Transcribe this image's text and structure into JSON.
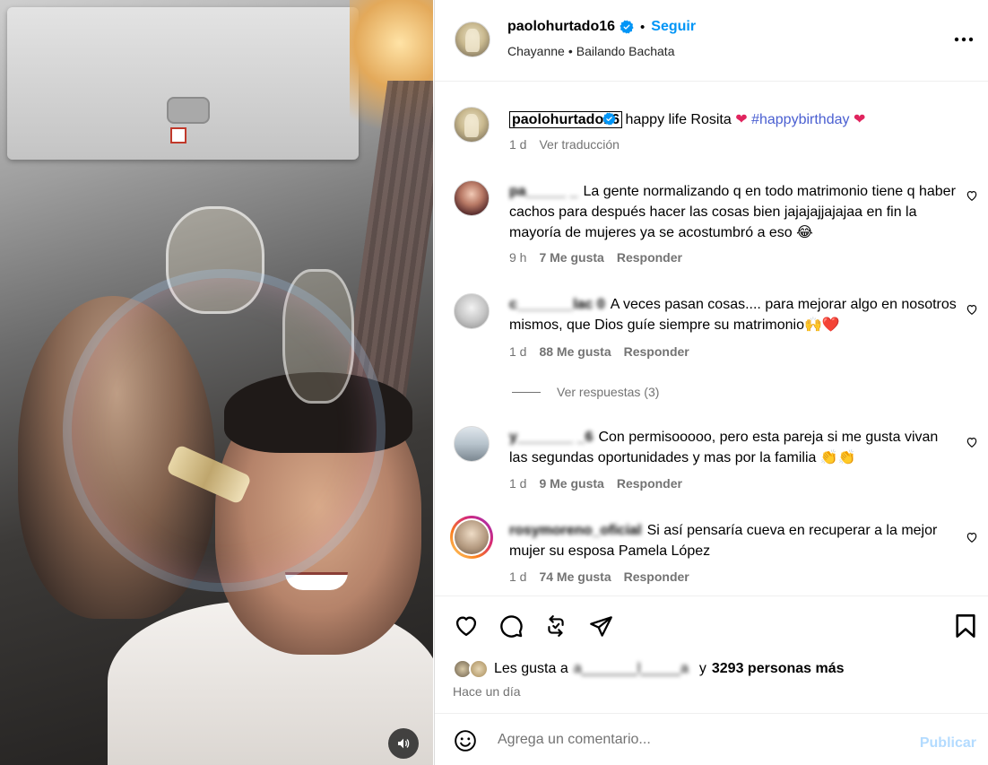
{
  "post": {
    "username": "paolohurtado16",
    "follow_label": "Seguir",
    "separator": "•",
    "song_artist": "Chayanne",
    "song_title": "Bailando Bachata",
    "caption_username": "paolohurtado16",
    "caption_text": "happy life Rosita",
    "caption_hashtag": "#happybirthday",
    "caption_time": "1 d",
    "caption_translate": "Ver traducción"
  },
  "comments": [
    {
      "username": "pa_____ _",
      "text": "La gente normalizando q en todo matrimonio tiene q haber cachos para después hacer las cosas bien jajajajjajajaa en fin la mayoría de mujeres ya se acostumbró a eso 😂",
      "time": "9 h",
      "likes": "7 Me gusta",
      "reply": "Responder"
    },
    {
      "username": "c_______lac 0",
      "text": "A veces pasan cosas.... para mejorar algo en nosotros mismos, que Dios guíe siempre su matrimonio🙌❤️",
      "time": "1 d",
      "likes": "88 Me gusta",
      "reply": "Responder",
      "view_replies": "Ver respuestas (3)"
    },
    {
      "username": "y_______ _6",
      "text": "Con permisooooo, pero esta pareja si me gusta vivan las segundas oportunidades y mas por la familia 👏👏",
      "time": "1 d",
      "likes": "9 Me gusta",
      "reply": "Responder"
    },
    {
      "username": "rosymoreno_oficial",
      "text": "Si así pensaría cueva en recuperar a la mejor mujer su esposa Pamela López",
      "time": "1 d",
      "likes": "74 Me gusta",
      "reply": "Responder"
    }
  ],
  "likes": {
    "prefix": "Les gusta a",
    "hidden_user": "a_______l_____a",
    "suffix": "y",
    "count_text": "3293 personas más"
  },
  "time_ago": "Hace un día",
  "composer": {
    "placeholder": "Agrega un comentario...",
    "publish_label": "Publicar"
  },
  "colors": {
    "accent": "#0095f6",
    "verified": "#0095f6",
    "muted": "#737373",
    "heart": "#e0245e",
    "publish_disabled": "#b3dbff"
  },
  "icons": [
    "verified-badge-icon",
    "more-options-icon",
    "heart-icon",
    "comment-icon",
    "repost-icon",
    "share-icon",
    "bookmark-icon",
    "emoji-icon",
    "volume-icon"
  ]
}
